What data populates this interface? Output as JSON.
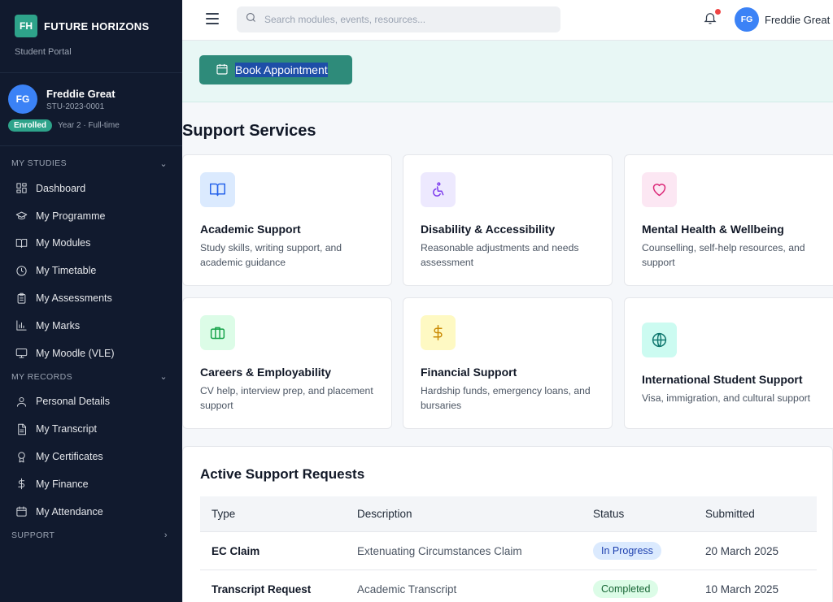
{
  "brand": {
    "logo": "FH",
    "name": "FUTURE HORIZONS",
    "subtitle": "Student Portal"
  },
  "profile": {
    "initials": "FG",
    "name": "Freddie Great",
    "id": "STU-2023-0001",
    "status": "Enrolled",
    "meta": "Year 2 · Full-time"
  },
  "sidebar": {
    "sections": [
      {
        "title": "MY STUDIES",
        "items": [
          {
            "label": "Dashboard",
            "icon": "dashboard-icon"
          },
          {
            "label": "My Programme",
            "icon": "graduation-cap-icon"
          },
          {
            "label": "My Modules",
            "icon": "book-icon"
          },
          {
            "label": "My Timetable",
            "icon": "clock-icon"
          },
          {
            "label": "My Assessments",
            "icon": "clipboard-icon"
          },
          {
            "label": "My Marks",
            "icon": "bar-chart-icon"
          },
          {
            "label": "My Moodle (VLE)",
            "icon": "monitor-icon"
          }
        ]
      },
      {
        "title": "MY RECORDS",
        "items": [
          {
            "label": "Personal Details",
            "icon": "user-icon"
          },
          {
            "label": "My Transcript",
            "icon": "document-icon"
          },
          {
            "label": "My Certificates",
            "icon": "award-icon"
          },
          {
            "label": "My Finance",
            "icon": "dollar-icon"
          },
          {
            "label": "My Attendance",
            "icon": "calendar-icon"
          }
        ]
      },
      {
        "title": "SUPPORT",
        "items": []
      }
    ]
  },
  "topbar": {
    "search_placeholder": "Search modules, events, resources...",
    "user_initials": "FG",
    "user_name": "Freddie Great"
  },
  "banner": {
    "button_label": "Book Appointment"
  },
  "page_title": "Support Services",
  "services": [
    {
      "title": "Academic Support",
      "desc": "Study skills, writing support, and academic guidance",
      "icon": "book-open-icon",
      "color": "#2563eb",
      "bg": "#dbeafe"
    },
    {
      "title": "Disability & Accessibility",
      "desc": "Reasonable adjustments and needs assessment",
      "icon": "accessibility-icon",
      "color": "#7c3aed",
      "bg": "#ede9fe"
    },
    {
      "title": "Mental Health & Wellbeing",
      "desc": "Counselling, self-help resources, and support",
      "icon": "heart-icon",
      "color": "#db2777",
      "bg": "#fce7f3"
    },
    {
      "title": "Careers & Employability",
      "desc": "CV help, interview prep, and placement support",
      "icon": "briefcase-icon",
      "color": "#16a34a",
      "bg": "#dcfce7"
    },
    {
      "title": "Financial Support",
      "desc": "Hardship funds, emergency loans, and bursaries",
      "icon": "dollar-icon",
      "color": "#ca8a04",
      "bg": "#fef9c3"
    },
    {
      "title": "International Student Support",
      "desc": "Visa, immigration, and cultural support",
      "icon": "globe-icon",
      "color": "#0f766e",
      "bg": "#ccfbf1"
    }
  ],
  "requests": {
    "title": "Active Support Requests",
    "columns": [
      "Type",
      "Description",
      "Status",
      "Submitted"
    ],
    "rows": [
      {
        "type": "EC Claim",
        "description": "Extenuating Circumstances Claim",
        "status": "In Progress",
        "submitted": "20 March 2025"
      },
      {
        "type": "Transcript Request",
        "description": "Academic Transcript",
        "status": "Completed",
        "submitted": "10 March 2025"
      }
    ]
  }
}
